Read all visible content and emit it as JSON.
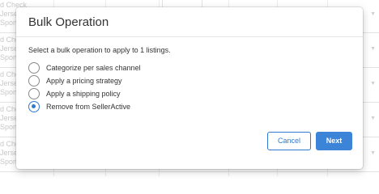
{
  "background": {
    "rows": [
      {
        "lines": [
          "d Check",
          "Jersey",
          "Sport"
        ]
      },
      {
        "lines": [
          "d Check",
          "Jersey",
          "Sport"
        ]
      },
      {
        "lines": [
          "d Check",
          "Jersey",
          "Sport"
        ]
      },
      {
        "lines": [
          "d Check",
          "Jersey",
          "Sport"
        ]
      },
      {
        "lines": [
          "d Check",
          "Jersey",
          "Sport"
        ]
      }
    ]
  },
  "modal": {
    "title": "Bulk Operation",
    "instruction": "Select a bulk operation to apply to 1 listings.",
    "options": [
      {
        "label": "Categorize per sales channel",
        "selected": false
      },
      {
        "label": "Apply a pricing strategy",
        "selected": false
      },
      {
        "label": "Apply a shipping policy",
        "selected": false
      },
      {
        "label": "Remove from SellerActive",
        "selected": true
      }
    ],
    "buttons": {
      "cancel_label": "Cancel",
      "next_label": "Next"
    }
  },
  "colors": {
    "accent": "#2f7ad0",
    "primary_button": "#3c84d7"
  }
}
